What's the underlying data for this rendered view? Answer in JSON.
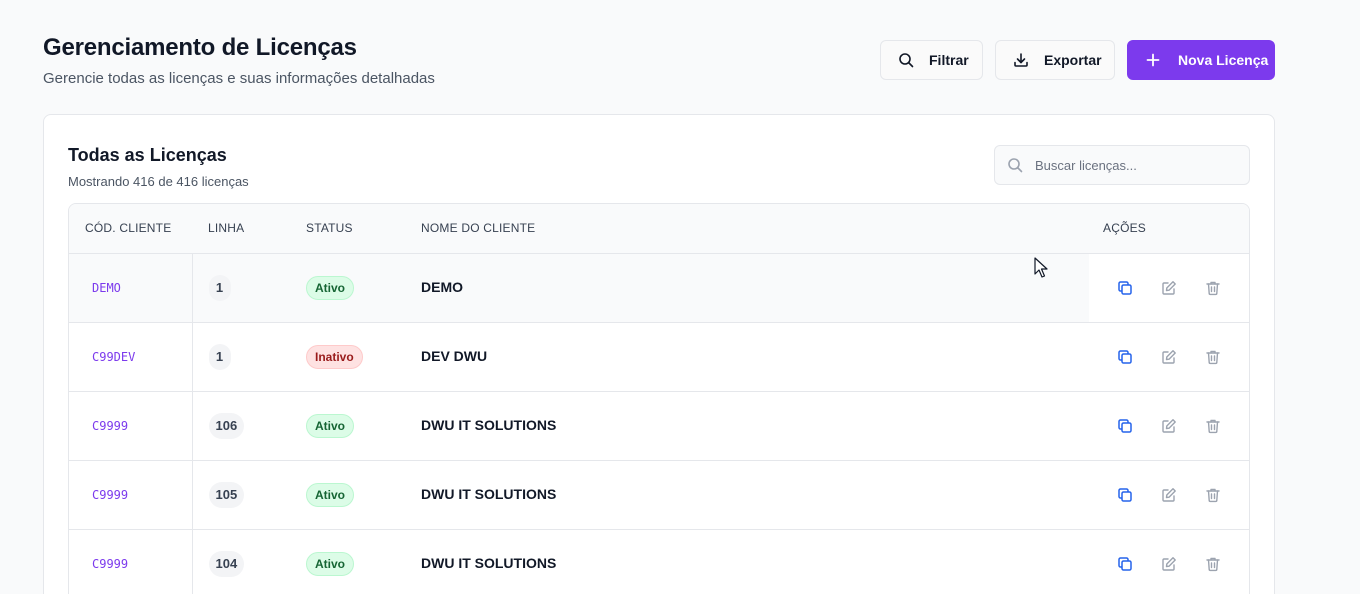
{
  "header": {
    "title": "Gerenciamento de Licenças",
    "subtitle": "Gerencie todas as licenças e suas informações detalhadas",
    "filter_label": "Filtrar",
    "export_label": "Exportar",
    "new_label": "Nova Licença"
  },
  "card": {
    "title": "Todas as Licenças",
    "subtitle": "Mostrando 416 de 416 licenças",
    "search_placeholder": "Buscar licenças..."
  },
  "table": {
    "columns": {
      "code": "CÓD. CLIENTE",
      "line": "LINHA",
      "status": "STATUS",
      "name": "NOME DO CLIENTE",
      "actions": "AÇÕES"
    },
    "rows": [
      {
        "code": "DEMO",
        "line": "1",
        "status": "Ativo",
        "name": "DEMO"
      },
      {
        "code": "C99DEV",
        "line": "1",
        "status": "Inativo",
        "name": "DEV DWU"
      },
      {
        "code": "C9999",
        "line": "106",
        "status": "Ativo",
        "name": "DWU IT SOLUTIONS"
      },
      {
        "code": "C9999",
        "line": "105",
        "status": "Ativo",
        "name": "DWU IT SOLUTIONS"
      },
      {
        "code": "C9999",
        "line": "104",
        "status": "Ativo",
        "name": "DWU IT SOLUTIONS"
      }
    ]
  },
  "icons": {
    "filter": "search-icon",
    "export": "download-icon",
    "new": "plus-icon",
    "search": "search-icon",
    "row_actions": [
      "copy-icon",
      "edit-icon",
      "trash-icon"
    ]
  },
  "colors": {
    "accent": "#7c3aed",
    "active_bg": "#dcfce7",
    "active_text": "#166534",
    "inactive_bg": "#fee2e2",
    "inactive_text": "#991b1b",
    "copy_icon": "#2563eb"
  }
}
